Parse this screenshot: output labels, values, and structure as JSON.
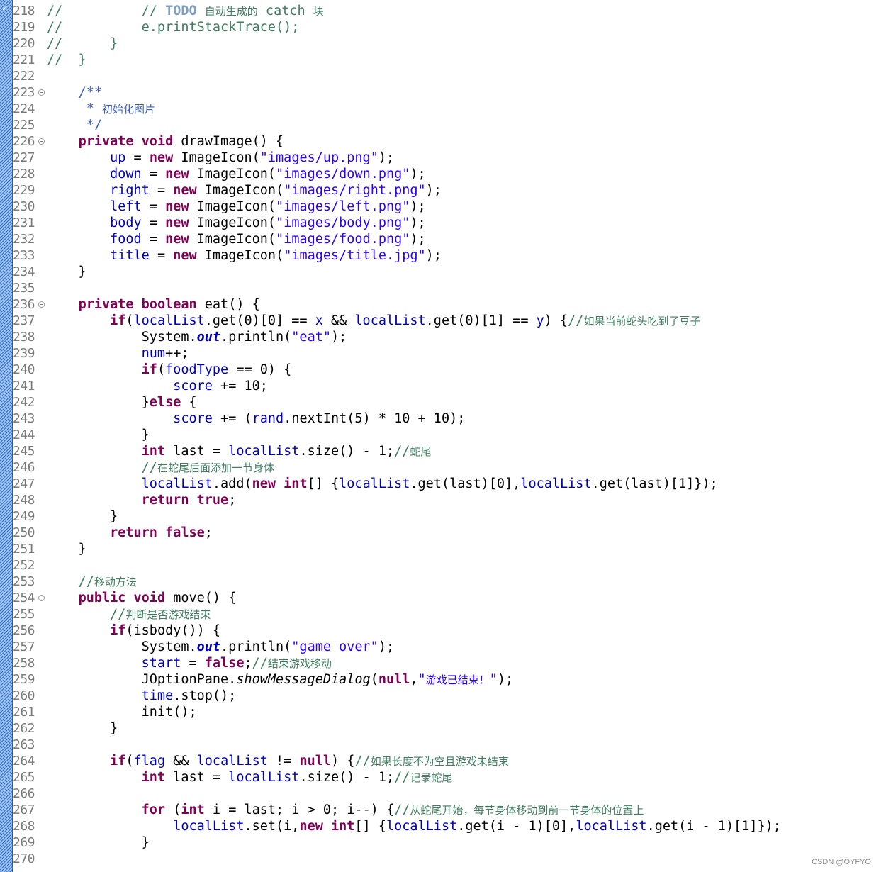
{
  "editor": {
    "language": "Java",
    "lines": [
      {
        "n": "218",
        "fold": false,
        "seg": [
          [
            "cm",
            "//          "
          ],
          [
            "cm",
            "// "
          ],
          [
            "todo",
            "TODO"
          ],
          [
            "cm",
            " "
          ],
          [
            "cm cn",
            "自动生成的"
          ],
          [
            "cm",
            " catch "
          ],
          [
            "cm cn",
            "块"
          ]
        ]
      },
      {
        "n": "219",
        "fold": false,
        "seg": [
          [
            "cm",
            "//          e.printStackTrace();"
          ]
        ]
      },
      {
        "n": "220",
        "fold": false,
        "seg": [
          [
            "cm",
            "//      }"
          ]
        ]
      },
      {
        "n": "221",
        "fold": false,
        "seg": [
          [
            "cm",
            "//  }"
          ]
        ]
      },
      {
        "n": "222",
        "fold": false,
        "seg": []
      },
      {
        "n": "223",
        "fold": true,
        "seg": [
          [
            "jd",
            "    /**"
          ]
        ]
      },
      {
        "n": "224",
        "fold": false,
        "seg": [
          [
            "jd",
            "     * "
          ],
          [
            "jd cn",
            "初始化图片"
          ]
        ]
      },
      {
        "n": "225",
        "fold": false,
        "seg": [
          [
            "jd",
            "     */"
          ]
        ]
      },
      {
        "n": "226",
        "fold": true,
        "seg": [
          [
            "",
            "    "
          ],
          [
            "kw",
            "private"
          ],
          [
            "",
            " "
          ],
          [
            "kw",
            "void"
          ],
          [
            "",
            " drawImage() {"
          ]
        ]
      },
      {
        "n": "227",
        "fold": false,
        "seg": [
          [
            "",
            "        "
          ],
          [
            "fld",
            "up"
          ],
          [
            "",
            " = "
          ],
          [
            "kw",
            "new"
          ],
          [
            "",
            " ImageIcon("
          ],
          [
            "str",
            "\"images/up.png\""
          ],
          [
            "",
            ");"
          ]
        ]
      },
      {
        "n": "228",
        "fold": false,
        "seg": [
          [
            "",
            "        "
          ],
          [
            "fld",
            "down"
          ],
          [
            "",
            " = "
          ],
          [
            "kw",
            "new"
          ],
          [
            "",
            " ImageIcon("
          ],
          [
            "str",
            "\"images/down.png\""
          ],
          [
            "",
            ");"
          ]
        ]
      },
      {
        "n": "229",
        "fold": false,
        "seg": [
          [
            "",
            "        "
          ],
          [
            "fld",
            "right"
          ],
          [
            "",
            " = "
          ],
          [
            "kw",
            "new"
          ],
          [
            "",
            " ImageIcon("
          ],
          [
            "str",
            "\"images/right.png\""
          ],
          [
            "",
            ");"
          ]
        ]
      },
      {
        "n": "230",
        "fold": false,
        "seg": [
          [
            "",
            "        "
          ],
          [
            "fld",
            "left"
          ],
          [
            "",
            " = "
          ],
          [
            "kw",
            "new"
          ],
          [
            "",
            " ImageIcon("
          ],
          [
            "str",
            "\"images/left.png\""
          ],
          [
            "",
            ");"
          ]
        ]
      },
      {
        "n": "231",
        "fold": false,
        "seg": [
          [
            "",
            "        "
          ],
          [
            "fld",
            "body"
          ],
          [
            "",
            " = "
          ],
          [
            "kw",
            "new"
          ],
          [
            "",
            " ImageIcon("
          ],
          [
            "str",
            "\"images/body.png\""
          ],
          [
            "",
            ");"
          ]
        ]
      },
      {
        "n": "232",
        "fold": false,
        "seg": [
          [
            "",
            "        "
          ],
          [
            "fld",
            "food"
          ],
          [
            "",
            " = "
          ],
          [
            "kw",
            "new"
          ],
          [
            "",
            " ImageIcon("
          ],
          [
            "str",
            "\"images/food.png\""
          ],
          [
            "",
            ");"
          ]
        ]
      },
      {
        "n": "233",
        "fold": false,
        "seg": [
          [
            "",
            "        "
          ],
          [
            "fld",
            "title"
          ],
          [
            "",
            " = "
          ],
          [
            "kw",
            "new"
          ],
          [
            "",
            " ImageIcon("
          ],
          [
            "str",
            "\"images/title.jpg\""
          ],
          [
            "",
            ");"
          ]
        ]
      },
      {
        "n": "234",
        "fold": false,
        "seg": [
          [
            "",
            "    }"
          ]
        ]
      },
      {
        "n": "235",
        "fold": false,
        "seg": []
      },
      {
        "n": "236",
        "fold": true,
        "seg": [
          [
            "",
            "    "
          ],
          [
            "kw",
            "private"
          ],
          [
            "",
            " "
          ],
          [
            "kw",
            "boolean"
          ],
          [
            "",
            " eat() {"
          ]
        ]
      },
      {
        "n": "237",
        "fold": false,
        "seg": [
          [
            "",
            "        "
          ],
          [
            "kw",
            "if"
          ],
          [
            "",
            "("
          ],
          [
            "fld",
            "localList"
          ],
          [
            "",
            ".get(0)[0] == "
          ],
          [
            "fld",
            "x"
          ],
          [
            "",
            " && "
          ],
          [
            "fld",
            "localList"
          ],
          [
            "",
            ".get(0)[1] == "
          ],
          [
            "fld",
            "y"
          ],
          [
            "",
            ") {"
          ],
          [
            "cm",
            "//"
          ],
          [
            "cm cn",
            "如果当前蛇头吃到了豆子"
          ]
        ]
      },
      {
        "n": "238",
        "fold": false,
        "seg": [
          [
            "",
            "            System."
          ],
          [
            "sf",
            "out"
          ],
          [
            "",
            ".println("
          ],
          [
            "str",
            "\"eat\""
          ],
          [
            "",
            ");"
          ]
        ]
      },
      {
        "n": "239",
        "fold": false,
        "seg": [
          [
            "",
            "            "
          ],
          [
            "fld",
            "num"
          ],
          [
            "",
            "++;"
          ]
        ]
      },
      {
        "n": "240",
        "fold": false,
        "seg": [
          [
            "",
            "            "
          ],
          [
            "kw",
            "if"
          ],
          [
            "",
            "("
          ],
          [
            "fld",
            "foodType"
          ],
          [
            "",
            " == 0) {"
          ]
        ]
      },
      {
        "n": "241",
        "fold": false,
        "seg": [
          [
            "",
            "                "
          ],
          [
            "fld",
            "score"
          ],
          [
            "",
            " += 10;"
          ]
        ]
      },
      {
        "n": "242",
        "fold": false,
        "seg": [
          [
            "",
            "            }"
          ],
          [
            "kw",
            "else"
          ],
          [
            "",
            " {"
          ]
        ]
      },
      {
        "n": "243",
        "fold": false,
        "seg": [
          [
            "",
            "                "
          ],
          [
            "fld",
            "score"
          ],
          [
            "",
            " += ("
          ],
          [
            "fld",
            "rand"
          ],
          [
            "",
            ".nextInt(5) * 10 + 10);"
          ]
        ]
      },
      {
        "n": "244",
        "fold": false,
        "seg": [
          [
            "",
            "            }"
          ]
        ]
      },
      {
        "n": "245",
        "fold": false,
        "seg": [
          [
            "",
            "            "
          ],
          [
            "kw",
            "int"
          ],
          [
            "",
            " last = "
          ],
          [
            "fld",
            "localList"
          ],
          [
            "",
            ".size() - 1;"
          ],
          [
            "cm",
            "//"
          ],
          [
            "cm cn",
            "蛇尾"
          ]
        ]
      },
      {
        "n": "246",
        "fold": false,
        "seg": [
          [
            "cm",
            "            //"
          ],
          [
            "cm cn",
            "在蛇尾后面添加一节身体"
          ]
        ]
      },
      {
        "n": "247",
        "fold": false,
        "seg": [
          [
            "",
            "            "
          ],
          [
            "fld",
            "localList"
          ],
          [
            "",
            ".add("
          ],
          [
            "kw",
            "new"
          ],
          [
            "",
            " "
          ],
          [
            "kw",
            "int"
          ],
          [
            "",
            "[] {"
          ],
          [
            "fld",
            "localList"
          ],
          [
            "",
            ".get(last)[0],"
          ],
          [
            "fld",
            "localList"
          ],
          [
            "",
            ".get(last)[1]});"
          ]
        ]
      },
      {
        "n": "248",
        "fold": false,
        "seg": [
          [
            "",
            "            "
          ],
          [
            "kw",
            "return"
          ],
          [
            "",
            " "
          ],
          [
            "kw",
            "true"
          ],
          [
            "",
            ";"
          ]
        ]
      },
      {
        "n": "249",
        "fold": false,
        "seg": [
          [
            "",
            "        }"
          ]
        ]
      },
      {
        "n": "250",
        "fold": false,
        "seg": [
          [
            "",
            "        "
          ],
          [
            "kw",
            "return"
          ],
          [
            "",
            " "
          ],
          [
            "kw",
            "false"
          ],
          [
            "",
            ";"
          ]
        ]
      },
      {
        "n": "251",
        "fold": false,
        "seg": [
          [
            "",
            "    }"
          ]
        ]
      },
      {
        "n": "252",
        "fold": false,
        "seg": []
      },
      {
        "n": "253",
        "fold": false,
        "seg": [
          [
            "cm",
            "    //"
          ],
          [
            "cm cn",
            "移动方法"
          ]
        ]
      },
      {
        "n": "254",
        "fold": true,
        "seg": [
          [
            "",
            "    "
          ],
          [
            "kw",
            "public"
          ],
          [
            "",
            " "
          ],
          [
            "kw",
            "void"
          ],
          [
            "",
            " move() {"
          ]
        ]
      },
      {
        "n": "255",
        "fold": false,
        "seg": [
          [
            "cm",
            "        //"
          ],
          [
            "cm cn",
            "判断是否游戏结束"
          ]
        ]
      },
      {
        "n": "256",
        "fold": false,
        "seg": [
          [
            "",
            "        "
          ],
          [
            "kw",
            "if"
          ],
          [
            "",
            "(isbody()) {"
          ]
        ]
      },
      {
        "n": "257",
        "fold": false,
        "seg": [
          [
            "",
            "            System."
          ],
          [
            "sf",
            "out"
          ],
          [
            "",
            ".println("
          ],
          [
            "str",
            "\"game over\""
          ],
          [
            "",
            ");"
          ]
        ]
      },
      {
        "n": "258",
        "fold": false,
        "seg": [
          [
            "",
            "            "
          ],
          [
            "fld",
            "start"
          ],
          [
            "",
            " = "
          ],
          [
            "kw",
            "false"
          ],
          [
            "",
            ";"
          ],
          [
            "cm",
            "//"
          ],
          [
            "cm cn",
            "结束游戏移动"
          ]
        ]
      },
      {
        "n": "259",
        "fold": false,
        "seg": [
          [
            "",
            "            JOptionPane."
          ],
          [
            "st",
            "showMessageDialog"
          ],
          [
            "",
            "("
          ],
          [
            "kw",
            "null"
          ],
          [
            "",
            ","
          ],
          [
            "str",
            "\""
          ],
          [
            "str cn",
            "游戏已结束！"
          ],
          [
            "str",
            "\""
          ],
          [
            "",
            ");"
          ]
        ]
      },
      {
        "n": "260",
        "fold": false,
        "seg": [
          [
            "",
            "            "
          ],
          [
            "fld",
            "time"
          ],
          [
            "",
            ".stop();"
          ]
        ]
      },
      {
        "n": "261",
        "fold": false,
        "seg": [
          [
            "",
            "            init();"
          ]
        ]
      },
      {
        "n": "262",
        "fold": false,
        "seg": [
          [
            "",
            "        }"
          ]
        ]
      },
      {
        "n": "263",
        "fold": false,
        "seg": []
      },
      {
        "n": "264",
        "fold": false,
        "seg": [
          [
            "",
            "        "
          ],
          [
            "kw",
            "if"
          ],
          [
            "",
            "("
          ],
          [
            "fld",
            "flag"
          ],
          [
            "",
            " && "
          ],
          [
            "fld",
            "localList"
          ],
          [
            "",
            " != "
          ],
          [
            "kw",
            "null"
          ],
          [
            "",
            ") {"
          ],
          [
            "cm",
            "//"
          ],
          [
            "cm cn",
            "如果长度不为空且游戏未结束"
          ]
        ]
      },
      {
        "n": "265",
        "fold": false,
        "seg": [
          [
            "",
            "            "
          ],
          [
            "kw",
            "int"
          ],
          [
            "",
            " last = "
          ],
          [
            "fld",
            "localList"
          ],
          [
            "",
            ".size() - 1;"
          ],
          [
            "cm",
            "//"
          ],
          [
            "cm cn",
            "记录蛇尾"
          ]
        ]
      },
      {
        "n": "266",
        "fold": false,
        "seg": []
      },
      {
        "n": "267",
        "fold": false,
        "seg": [
          [
            "",
            "            "
          ],
          [
            "kw",
            "for"
          ],
          [
            "",
            " ("
          ],
          [
            "kw",
            "int"
          ],
          [
            "",
            " i = last; i > 0; i--) {"
          ],
          [
            "cm",
            "//"
          ],
          [
            "cm cn",
            "从蛇尾开始，每节身体移动到前一节身体的位置上"
          ]
        ]
      },
      {
        "n": "268",
        "fold": false,
        "seg": [
          [
            "",
            "                "
          ],
          [
            "fld",
            "localList"
          ],
          [
            "",
            ".set(i,"
          ],
          [
            "kw",
            "new"
          ],
          [
            "",
            " "
          ],
          [
            "kw",
            "int"
          ],
          [
            "",
            "[] {"
          ],
          [
            "fld",
            "localList"
          ],
          [
            "",
            ".get(i - 1)[0],"
          ],
          [
            "fld",
            "localList"
          ],
          [
            "",
            ".get(i - 1)[1]});"
          ]
        ]
      },
      {
        "n": "269",
        "fold": false,
        "seg": [
          [
            "",
            "            }"
          ]
        ]
      },
      {
        "n": "270",
        "fold": false,
        "seg": []
      }
    ]
  },
  "watermark": "CSDN @OYFYO"
}
